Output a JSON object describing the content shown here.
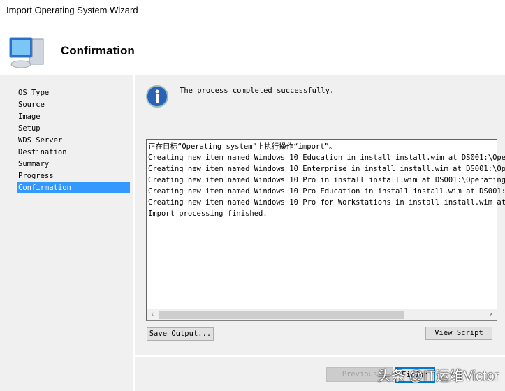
{
  "window": {
    "title": "Import Operating System Wizard"
  },
  "header": {
    "title": "Confirmation"
  },
  "sidebar": {
    "items": [
      {
        "label": "OS Type"
      },
      {
        "label": "Source"
      },
      {
        "label": "Image"
      },
      {
        "label": "Setup"
      },
      {
        "label": "WDS Server"
      },
      {
        "label": "Destination"
      },
      {
        "label": "Summary"
      },
      {
        "label": "Progress"
      },
      {
        "label": "Confirmation",
        "selected": true
      }
    ]
  },
  "main": {
    "status_message": "The process completed successfully.",
    "output_lines": [
      "正在目标“Operating system”上执行操作“import”。",
      "Creating new item named Windows 10 Education in install install.wim at DS001:\\Oper",
      "Creating new item named Windows 10 Enterprise in install install.wim at DS001:\\Ope",
      "Creating new item named Windows 10 Pro in install install.wim at DS001:\\Operating",
      "Creating new item named Windows 10 Pro Education in install install.wim at DS001:\\",
      "Creating new item named Windows 10 Pro for Workstations in install install.wim at",
      "Import processing finished."
    ],
    "save_output_label": "Save Output...",
    "view_script_label": "View Script"
  },
  "footer": {
    "previous_label": "Previous",
    "finish_label": "Finish"
  },
  "watermark": "头条 @IT运维Victor"
}
